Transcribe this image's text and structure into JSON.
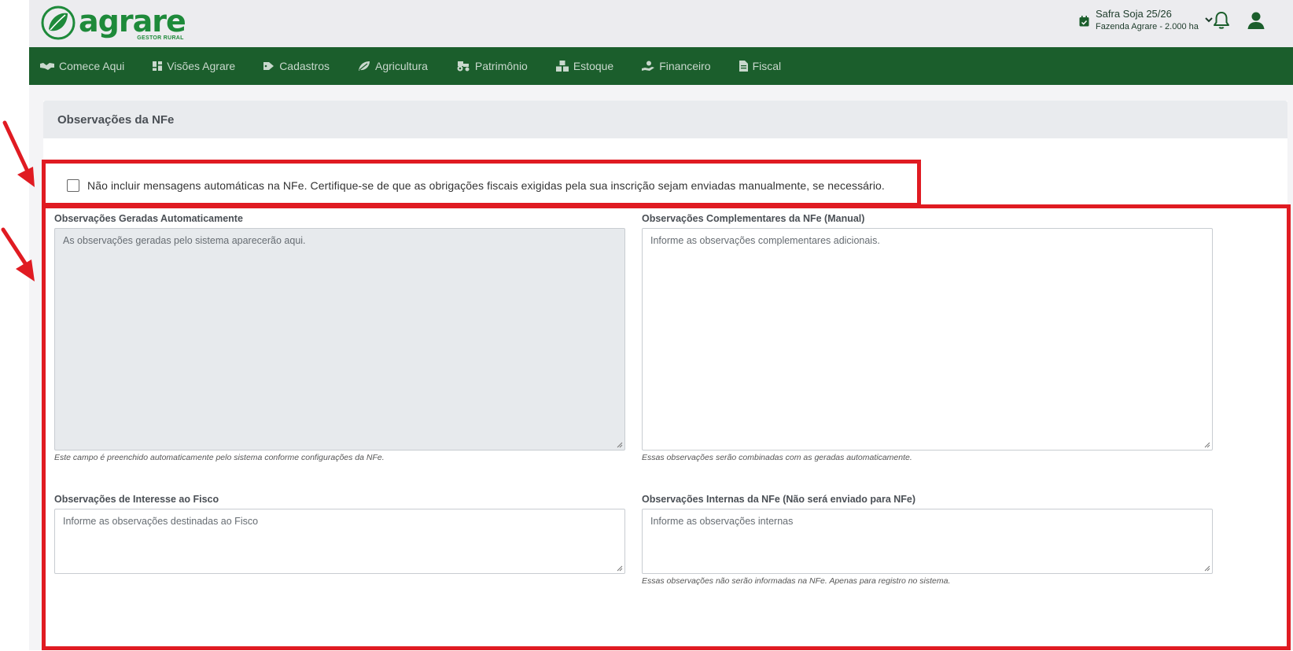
{
  "header": {
    "logo_word": "agrare",
    "logo_sub": "GESTOR RURAL",
    "season": "Safra Soja 25/26",
    "farm": "Fazenda Agrare - 2.000 ha"
  },
  "nav": {
    "items": [
      {
        "label": "Comece Aqui",
        "icon": "handshake-icon"
      },
      {
        "label": "Visões Agrare",
        "icon": "dashboard-icon"
      },
      {
        "label": "Cadastros",
        "icon": "tag-icon"
      },
      {
        "label": "Agricultura",
        "icon": "leaf-icon"
      },
      {
        "label": "Patrimônio",
        "icon": "tractor-icon"
      },
      {
        "label": "Estoque",
        "icon": "boxes-icon"
      },
      {
        "label": "Financeiro",
        "icon": "hand-coin-icon"
      },
      {
        "label": "Fiscal",
        "icon": "invoice-icon"
      }
    ]
  },
  "card": {
    "title": "Observações da NFe",
    "checkbox_label": "Não incluir mensagens automáticas na NFe. Certifique-se de que as obrigações fiscais exigidas pela sua inscrição sejam enviadas manualmente, se necessário.",
    "checkbox_checked": false,
    "fields": {
      "auto": {
        "label": "Observações Geradas Automaticamente",
        "placeholder": "As observações geradas pelo sistema aparecerão aqui.",
        "help": "Este campo é preenchido automaticamente pelo sistema conforme configurações da NFe."
      },
      "complementary": {
        "label": "Observações Complementares da NFe (Manual)",
        "placeholder": "Informe as observações complementares adicionais.",
        "help": "Essas observações serão combinadas com as geradas automaticamente."
      },
      "fisco": {
        "label": "Observações de Interesse ao Fisco",
        "placeholder": "Informe as observações destinadas ao Fisco"
      },
      "internal": {
        "label": "Observações Internas da NFe (Não será enviado para NFe)",
        "placeholder": "Informe as observações internas",
        "help": "Essas observações não serão informadas na NFe. Apenas para registro no sistema."
      }
    }
  },
  "colors": {
    "nav_bg": "#1b5e2c",
    "brand_green": "#1e8a3a",
    "annotation_red": "#e01b22"
  }
}
